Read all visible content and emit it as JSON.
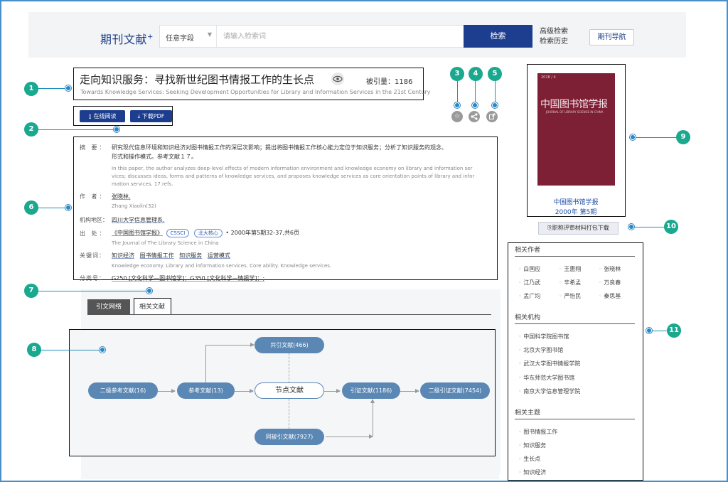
{
  "header": {
    "logo": "期刊文献",
    "logo_plus": "+",
    "field_select": "任意字段",
    "search_placeholder": "请输入检索词",
    "search_button": "检索",
    "advanced_search": "高级检索",
    "search_history": "检索历史",
    "journal_nav": "期刊导航"
  },
  "markers": [
    "1",
    "2",
    "3",
    "4",
    "5",
    "6",
    "7",
    "8",
    "9",
    "10",
    "11"
  ],
  "article": {
    "title": "走向知识服务：寻找新世纪图书情报工作的生长点",
    "cited_label": "被引量：",
    "cited_count": "1186",
    "subtitle_en": "Towards Knowledge Services: Seeking Development Opportunities for Library and Information Services in the 21st Century",
    "read_online": "在线阅读",
    "download_pdf": "下载PDF"
  },
  "details": {
    "abstract_label": "摘 要：",
    "abstract_cn_1": "研究现代信息环境和知识经济对图书情报工作的深层次影响；提出将图书情报工作核心能力定位于知识服务；分析了知识服务的观念、",
    "abstract_cn_2": "形式和操作模式。参考文献１７。",
    "abstract_en_1": "In this paper, the author analyzes deep-level effects of modern information environment and knowledge economy on library and information ser",
    "abstract_en_2": "vices; discusses ideas, forms and patterns of knowledge services, and proposes knowledge services as core orientation points of library and infor",
    "abstract_en_3": "mation services. 17 refs.",
    "author_label": "作 者：",
    "author_cn": "张晓林,",
    "author_en": "Zhang Xiaolin(32)",
    "org_label": "机构地区：",
    "org": "四川大学信息管理系,",
    "source_label": "出 处：",
    "source_journal": "《中国图书馆学报》",
    "tag_cssci": "CSSCI",
    "tag_pku": "北大核心",
    "source_issue": "• 2000年第5期32-37,共6页",
    "source_en": "The Journal of The Library Science in China",
    "keywords_label": "关键词：",
    "keywords": [
      "知识经济",
      "图书情报工作",
      "知识服务",
      "运营模式"
    ],
    "keywords_en": "Knowledge economy. Library and information services. Core ability. Knowledge services.",
    "class_label": "分类号：",
    "class_value": "G250 [文化科学—图书馆学]；G350 [文化科学—情报学]；;"
  },
  "tabs": {
    "citation_network": "引文网络",
    "related_docs": "相关文献"
  },
  "network": {
    "co_cited": "共引文献(466)",
    "secondary_refs": "二级参考文献(16)",
    "references": "参考文献(13)",
    "node_doc": "节点文献",
    "citing": "引证文献(1186)",
    "secondary_citing": "二级引证文献(7454)",
    "co_citing": "同被引文献(7927)"
  },
  "cover": {
    "top_text": "2018 / 4",
    "title": "中国图书馆学报",
    "subtitle_en": "JOURNAL OF LIBRARY SCIENCE IN CHINA",
    "journal_name": "中国图书馆学报",
    "issue": "2000年 第5期",
    "eval_button": "职称评审材料打包下载"
  },
  "related": {
    "authors_head": "相关作者",
    "authors": [
      "白国应",
      "王惠翔",
      "张晓林",
      "江乃武",
      "辛希孟",
      "万良春",
      "孟广均",
      "严怡民",
      "秦思基"
    ],
    "orgs_head": "相关机构",
    "orgs": [
      "中国科学院图书馆",
      "北京大学图书馆",
      "武汉大学图书情报学院",
      "华东师范大学图书馆",
      "南京大学信息管理学院"
    ],
    "topics_head": "相关主题",
    "topics": [
      "图书情报工作",
      "知识服务",
      "生长点",
      "知识经济"
    ]
  },
  "colors": {
    "brand": "#1d3d8f",
    "marker": "#1aa88f",
    "node": "#5b87b5",
    "cover": "#7d1f35"
  }
}
